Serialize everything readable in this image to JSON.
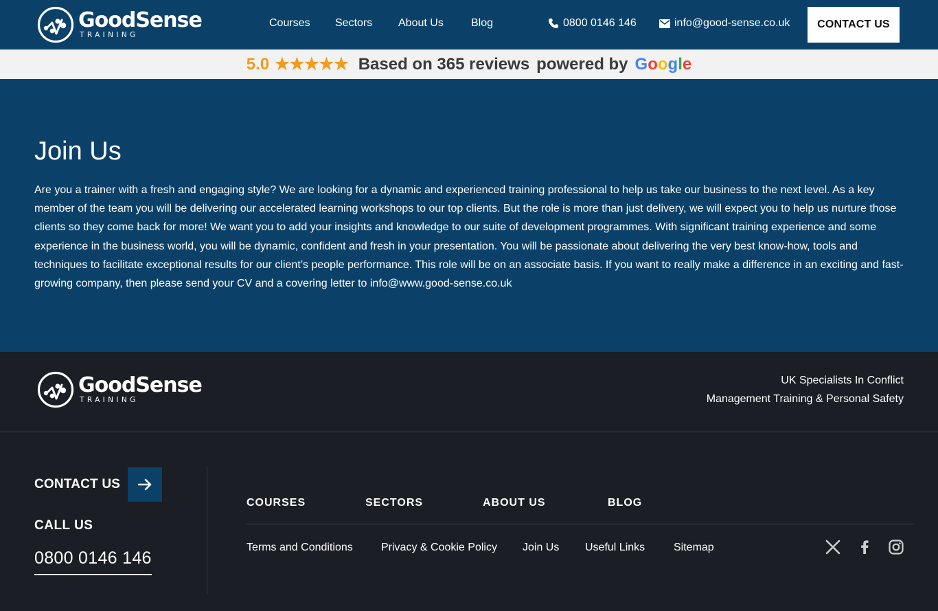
{
  "header": {
    "logo": {
      "brand": "GoodSense",
      "sub": "TRAINING"
    },
    "nav": [
      "Courses",
      "Sectors",
      "About Us",
      "Blog"
    ],
    "phone": "0800 0146 146",
    "email": "info@good-sense.co.uk",
    "contact_button": "CONTACT US",
    "icons": {
      "phone": "phone-icon",
      "email": "envelope-icon"
    },
    "bg_color": "#0b4168"
  },
  "reviews": {
    "score": "5.0",
    "stars": "★★★★★",
    "rating_value": 5,
    "based_on": "Based on 365 reviews",
    "powered_by": "powered by",
    "google": [
      "G",
      "o",
      "o",
      "g",
      "l",
      "e"
    ],
    "star_color": "#f39b1c"
  },
  "main": {
    "title": "Join Us",
    "body": "Are you a trainer with a fresh and engaging style? We are looking for a dynamic and experienced training professional to help us take our business to the next level. As a key member of the team you will be delivering our accelerated learning workshops to our top clients. But the role is more than just delivery, we will expect you to help us nurture those clients so they come back for more! We want you to add your insights and knowledge to our suite of development programmes. With significant training experience and some experience in the business world, you will be dynamic, confident and fresh in your presentation. You will be passionate about delivering the very best know-how, tools and techniques to facilitate exceptional results for our client’s people performance. This role will be on an associate basis. If you want to really make a difference in an exciting and fast-growing company, then please send your CV and a covering letter to info@www.good-sense.co.uk"
  },
  "footer": {
    "logo": {
      "brand": "GoodSense",
      "sub": "TRAINING"
    },
    "tagline_line1": "UK Specialists In Conflict",
    "tagline_line2": "Management Training & Personal Safety",
    "contact_label": "CONTACT US",
    "call_label": "CALL US",
    "call_number": "0800 0146 146",
    "nav": [
      "COURSES",
      "SECTORS",
      "ABOUT US",
      "BLOG"
    ],
    "links": [
      "Terms and Conditions",
      "Privacy & Cookie Policy",
      "Join Us",
      "Useful Links",
      "Sitemap"
    ],
    "social": [
      "x-icon",
      "facebook-icon",
      "instagram-icon"
    ],
    "bg_color": "#1b1e24"
  }
}
